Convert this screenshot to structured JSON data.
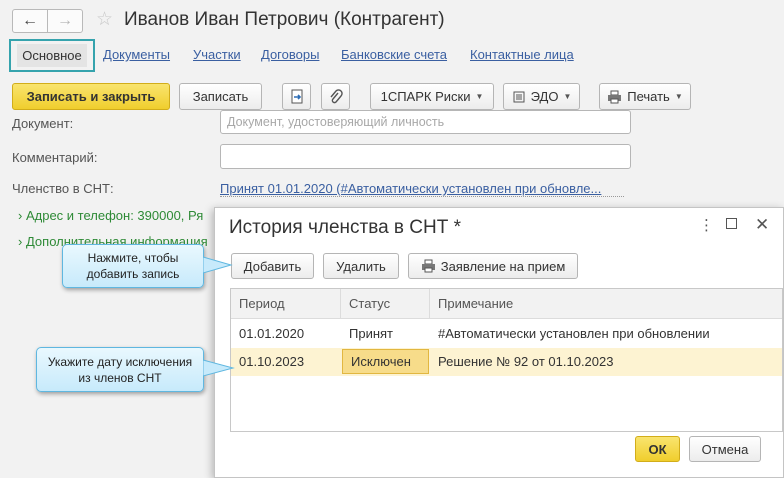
{
  "header": {
    "title": "Иванов Иван Петрович (Контрагент)",
    "back_icon": "←",
    "forward_icon": "→",
    "star_icon": "☆"
  },
  "tabs": [
    {
      "label": "Основное",
      "active": true
    },
    {
      "label": "Документы"
    },
    {
      "label": "Участки"
    },
    {
      "label": "Договоры"
    },
    {
      "label": "Банковские счета"
    },
    {
      "label": "Контактные лица"
    }
  ],
  "toolbar": {
    "save_close": "Записать и закрыть",
    "save": "Записать",
    "spark": "1СПАРК Риски",
    "edo": "ЭДО",
    "print": "Печать"
  },
  "form": {
    "document_label": "Документ:",
    "document_placeholder": "Документ, удостоверяющий личность",
    "comment_label": "Комментарий:",
    "comment_value": "",
    "membership_label": "Членство в СНТ:",
    "membership_link": "Принят 01.01.2020 (#Автоматически установлен при обновле...",
    "address_group": "Адрес и телефон: 390000, Ря",
    "extra_group": "Дополнительная информация"
  },
  "dialog": {
    "title": "История членства в СНТ *",
    "add": "Добавить",
    "delete": "Удалить",
    "application": "Заявление на прием",
    "columns": [
      "Период",
      "Статус",
      "Примечание"
    ],
    "rows": [
      {
        "period": "01.01.2020",
        "status": "Принят",
        "note": "#Автоматически установлен при обновлении"
      },
      {
        "period": "01.10.2023",
        "status": "Исключен",
        "note": "Решение № 92 от 01.10.2023",
        "selected": true
      }
    ],
    "ok": "ОК",
    "cancel": "Отмена"
  },
  "callouts": {
    "add_hint": "Нажмите, чтобы добавить запись",
    "date_hint": "Укажите дату исключения из членов СНТ"
  },
  "colors": {
    "accent": "#35a3ad",
    "primary_button": "#f0ce2d",
    "link": "#3a5fa1",
    "group": "#2e8a36",
    "selected_row": "#fdf3d2"
  }
}
